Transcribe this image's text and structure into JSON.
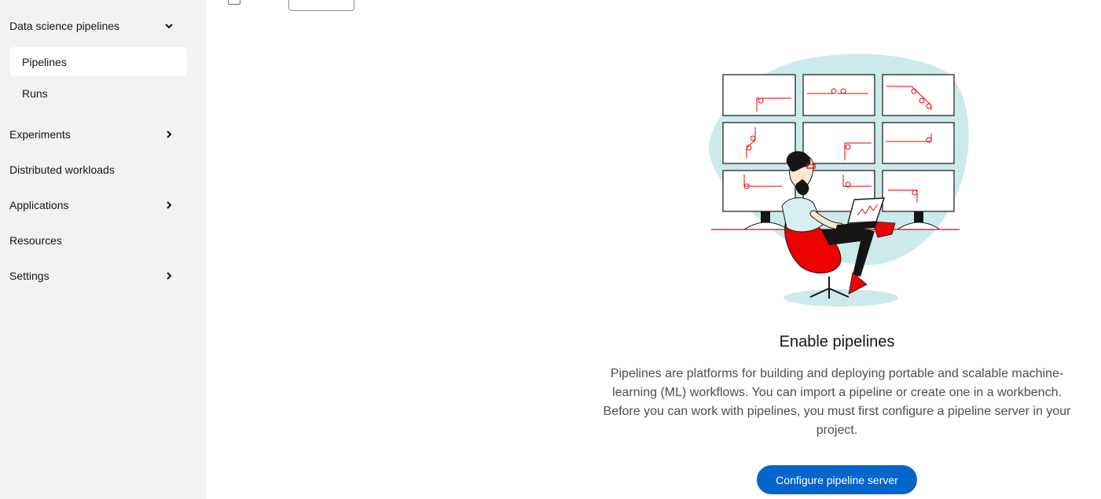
{
  "sidebar": {
    "groups": [
      {
        "label": "Data science pipelines",
        "expanded": true
      },
      {
        "label": "Experiments"
      },
      {
        "label": "Distributed workloads"
      },
      {
        "label": "Applications"
      },
      {
        "label": "Resources"
      },
      {
        "label": "Settings"
      }
    ],
    "subitems": [
      {
        "label": "Pipelines",
        "active": true
      },
      {
        "label": "Runs"
      }
    ]
  },
  "toolbar": {
    "partial_text": ""
  },
  "empty_state": {
    "title": "Enable pipelines",
    "description": "Pipelines are platforms for building and deploying portable and scalable machine-learning (ML) workflows. You can import a pipeline or create one in a workbench. Before you can work with pipelines, you must first configure a pipeline server in your project.",
    "action_label": "Configure pipeline server"
  },
  "colors": {
    "primary": "#0066cc",
    "sidebar_bg": "#f2f2f2",
    "accent_red": "#ee0000",
    "teal": "#cdeaea"
  }
}
